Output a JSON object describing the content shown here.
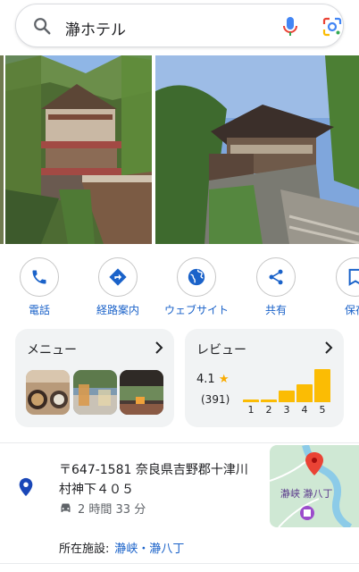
{
  "search": {
    "query": "瀞ホテル"
  },
  "actions": [
    {
      "label": "電話",
      "icon": "phone-icon"
    },
    {
      "label": "経路案内",
      "icon": "directions-icon"
    },
    {
      "label": "ウェブサイト",
      "icon": "globe-icon"
    },
    {
      "label": "共有",
      "icon": "share-icon"
    },
    {
      "label": "保存",
      "icon": "bookmark-icon"
    }
  ],
  "menu": {
    "title": "メニュー"
  },
  "reviews": {
    "title": "レビュー",
    "rating": "4.1",
    "count": "(391)",
    "distribution": {
      "labels": [
        "1",
        "2",
        "3",
        "4",
        "5"
      ],
      "fractions": [
        0.07,
        0.07,
        0.3,
        0.45,
        0.85
      ]
    }
  },
  "address": {
    "line": "〒647-1581 奈良県吉野郡十津川村神下４０５",
    "drive_time": "2 時間 33 分",
    "facility_label": "所在施設:",
    "facility_name": "瀞峡・瀞八丁"
  },
  "map": {
    "label": "瀞峡 瀞八丁"
  },
  "colors": {
    "accent": "#1a62c9",
    "star": "#fbbc04",
    "pin": "#1a47b8"
  }
}
